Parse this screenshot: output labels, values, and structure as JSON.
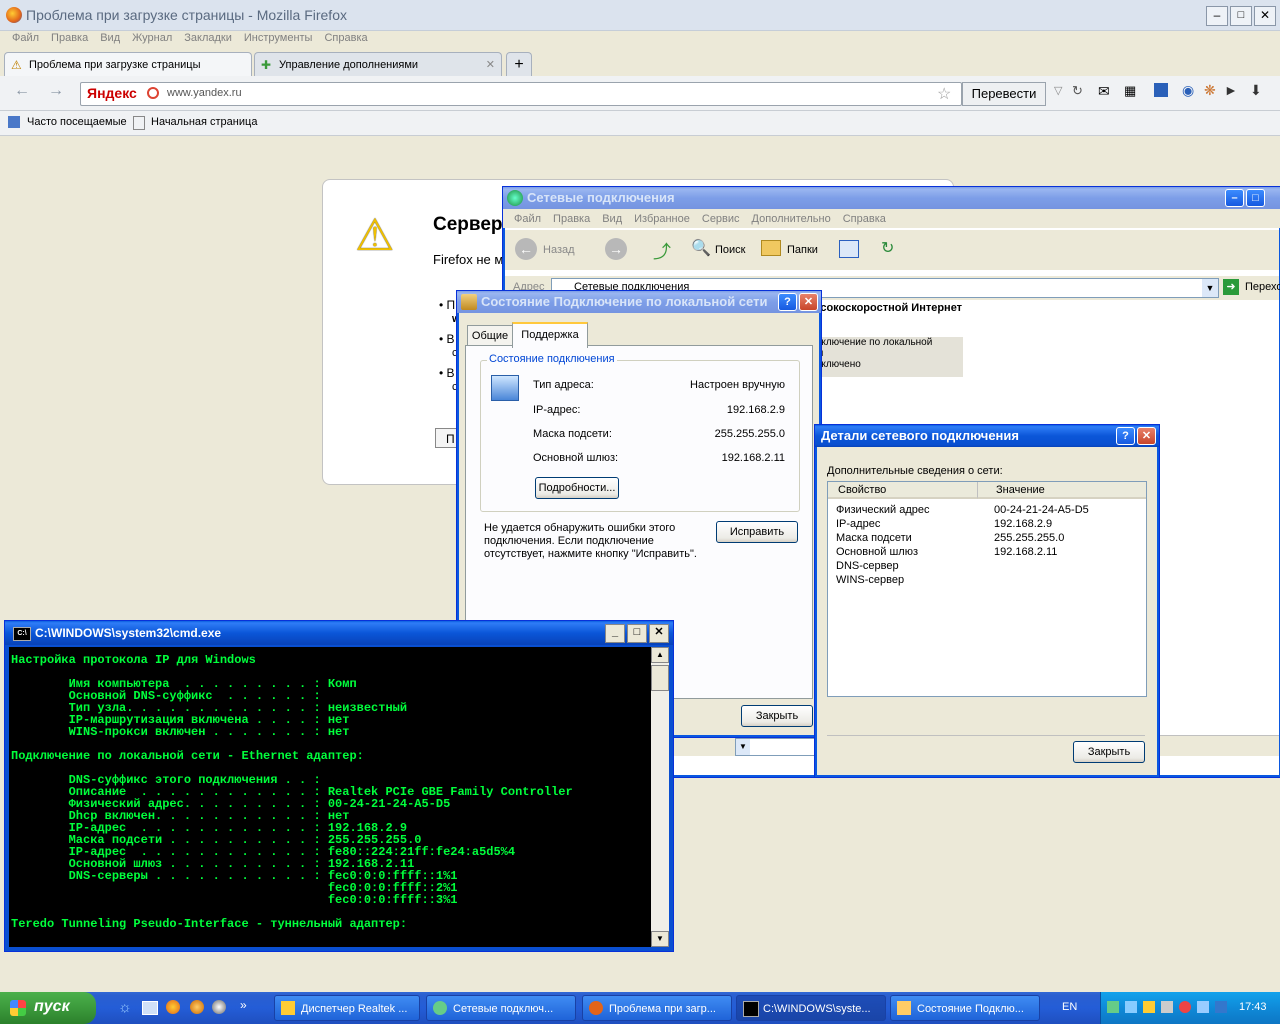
{
  "firefox": {
    "title": "Проблема при загрузке страницы - Mozilla Firefox",
    "menu": [
      "Файл",
      "Правка",
      "Вид",
      "Журнал",
      "Закладки",
      "Инструменты",
      "Справка"
    ],
    "tabs": [
      "Проблема при загрузке страницы",
      "Управление дополнениями"
    ],
    "new_tab": "+",
    "search_engine": "Яндекс",
    "url": "www.yandex.ru",
    "translate": "Перевести",
    "bookmarks": [
      "Часто посещаемые",
      "Начальная страница"
    ],
    "error_title": "Сервер",
    "error_text": "Firefox не м",
    "bullets": [
      "П",
      "w",
      "В",
      "с",
      "В",
      "с"
    ],
    "retry_label": "П"
  },
  "netconn": {
    "title": "Сетевые подключения",
    "menu": [
      "Файл",
      "Правка",
      "Вид",
      "Избранное",
      "Сервис",
      "Дополнительно",
      "Справка"
    ],
    "back": "Назад",
    "search": "Поиск",
    "folders": "Папки",
    "address_label": "Адрес",
    "address_value": "Сетевые подключения",
    "go": "Переход",
    "group_header": "Высокоскоростной Интернет",
    "conn_lines": [
      "Подключение по локальной",
      "сети",
      "Подключено"
    ]
  },
  "status_dialog": {
    "title": "Состояние Подключение по локальной сети",
    "tabs": [
      "Общие",
      "Поддержка"
    ],
    "group_label": "Состояние подключения",
    "rows": [
      {
        "label": "Тип адреса:",
        "value": "Настроен вручную"
      },
      {
        "label": "IP-адрес:",
        "value": "192.168.2.9"
      },
      {
        "label": "Маска подсети:",
        "value": "255.255.255.0"
      },
      {
        "label": "Основной шлюз:",
        "value": "192.168.2.11"
      }
    ],
    "details_button": "Подробности...",
    "hint": [
      "Не удается обнаружить ошибки этого",
      "подключения. Если подключение",
      "отсутствует, нажмите кнопку \"Исправить\"."
    ],
    "repair_button": "Исправить",
    "close_button": "Закрыть"
  },
  "details_dialog": {
    "title": "Детали сетевого подключения",
    "label": "Дополнительные сведения о сети:",
    "columns": [
      "Свойство",
      "Значение"
    ],
    "rows": [
      [
        "Физический адрес",
        "00-24-21-24-A5-D5"
      ],
      [
        "IP-адрес",
        "192.168.2.9"
      ],
      [
        "Маска подсети",
        "255.255.255.0"
      ],
      [
        "Основной шлюз",
        "192.168.2.11"
      ],
      [
        "DNS-сервер",
        ""
      ],
      [
        "WINS-сервер",
        ""
      ]
    ],
    "close_button": "Закрыть"
  },
  "cmd": {
    "title": "C:\\WINDOWS\\system32\\cmd.exe",
    "lines": [
      "Настройка протокола IP для Windows",
      "",
      "        Имя компьютера  . . . . . . . . . : Комп",
      "        Основной DNS-суффикс  . . . . . . :",
      "        Тип узла. . . . . . . . . . . . . : неизвестный",
      "        IP-маршрутизация включена . . . . : нет",
      "        WINS-прокси включен . . . . . . . : нет",
      "",
      "Подключение по локальной сети - Ethernet адаптер:",
      "",
      "        DNS-суффикс этого подключения . . :",
      "        Описание  . . . . . . . . . . . . : Realtek PCIe GBE Family Controller",
      "        Физический адрес. . . . . . . . . : 00-24-21-24-A5-D5",
      "        Dhcp включен. . . . . . . . . . . : нет",
      "        IP-адрес  . . . . . . . . . . . . : 192.168.2.9",
      "        Маска подсети . . . . . . . . . . : 255.255.255.0",
      "        IP-адрес  . . . . . . . . . . . . : fe80::224:21ff:fe24:a5d5%4",
      "        Основной шлюз . . . . . . . . . . : 192.168.2.11",
      "        DNS-серверы . . . . . . . . . . . : fec0:0:0:ffff::1%1",
      "                                            fec0:0:0:ffff::2%1",
      "                                            fec0:0:0:ffff::3%1",
      "",
      "Teredo Tunneling Pseudo-Interface - туннельный адаптер:"
    ]
  },
  "taskbar": {
    "start": "пуск",
    "items": [
      "Диспетчер Realtek ...",
      "Сетевые подключ...",
      "Проблема при загр...",
      "C:\\WINDOWS\\syste...",
      "Состояние Подклю..."
    ],
    "lang": "EN",
    "clock": "17:43"
  },
  "icons": {
    "warning": "warning-icon",
    "network": "network-icon"
  },
  "colors": {
    "xp_blue": "#0a4fd0",
    "cmd_green": "#00ff3c",
    "start_green": "#3c9a3c"
  }
}
